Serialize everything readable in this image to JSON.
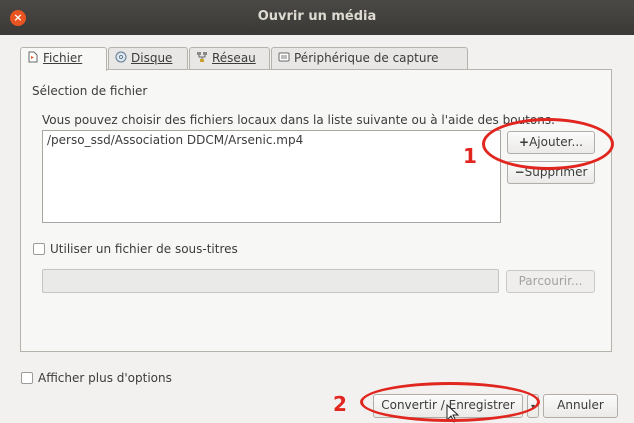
{
  "window": {
    "title": "Ouvrir un média"
  },
  "tabs": [
    {
      "label": "Fichier",
      "icon": "file-icon",
      "active": true
    },
    {
      "label": "Disque",
      "icon": "disc-icon",
      "active": false
    },
    {
      "label": "Réseau",
      "icon": "network-icon",
      "active": false
    },
    {
      "label": "Périphérique de capture",
      "icon": "capture-device-icon",
      "active": false
    }
  ],
  "file_selection": {
    "heading": "Sélection de fichier",
    "description": "Vous pouvez choisir des fichiers locaux dans la liste suivante ou à l'aide des boutons.",
    "files": [
      "/perso_ssd/Association DDCM/Arsenic.mp4"
    ],
    "add_button": "Ajouter...",
    "remove_button": "Supprimer"
  },
  "subtitles": {
    "checkbox_label": "Utiliser un fichier de sous-titres",
    "path_value": "",
    "browse_button": "Parcourir..."
  },
  "more_options_label": "Afficher plus d'options",
  "footer": {
    "convert_button": "Convertir / Enregistrer",
    "cancel_button": "Annuler"
  },
  "annotations": [
    {
      "number": "1",
      "color": "#e0261e"
    },
    {
      "number": "2",
      "color": "#e0261e"
    }
  ]
}
